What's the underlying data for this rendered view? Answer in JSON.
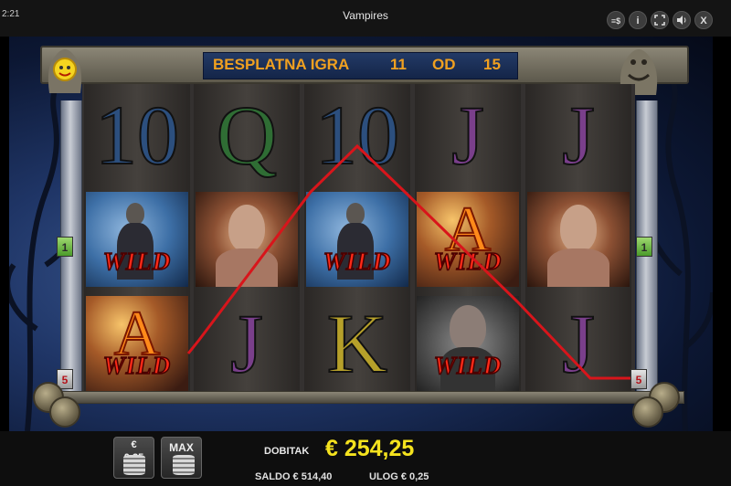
{
  "app": {
    "clock": "2:21",
    "title": "Vampires"
  },
  "toolbar": {
    "paytable_icon": "≡$",
    "info_icon": "i",
    "fullscreen_icon": "⛶",
    "sound_icon": "🔈",
    "close_icon": "X"
  },
  "banner": {
    "label": "BESPLATNA IGRA",
    "current": "11",
    "of": "OD",
    "total": "15"
  },
  "reels": {
    "row1": [
      "10",
      "Q",
      "10",
      "J",
      "J"
    ],
    "row2": [
      "WILD",
      "",
      "WILD",
      "WILD",
      ""
    ],
    "row3_labels": [
      "WILD",
      "J",
      "K",
      "WILD",
      "J"
    ],
    "letter_a": "A"
  },
  "paylines": {
    "left_marker_1": "1",
    "right_marker_1": "1",
    "left_marker_5": "5",
    "right_marker_5": "5",
    "colors": {
      "line1": "#6ed22a",
      "line5": "#d8151b"
    }
  },
  "bottom": {
    "bet_button_currency": "€",
    "bet_button_value": "0,25",
    "max_button_label": "MAX",
    "win_label": "DOBITAK",
    "win_value": "€ 254,25",
    "saldo": "SALDO € 514,40",
    "ulog": "ULOG € 0,25"
  }
}
